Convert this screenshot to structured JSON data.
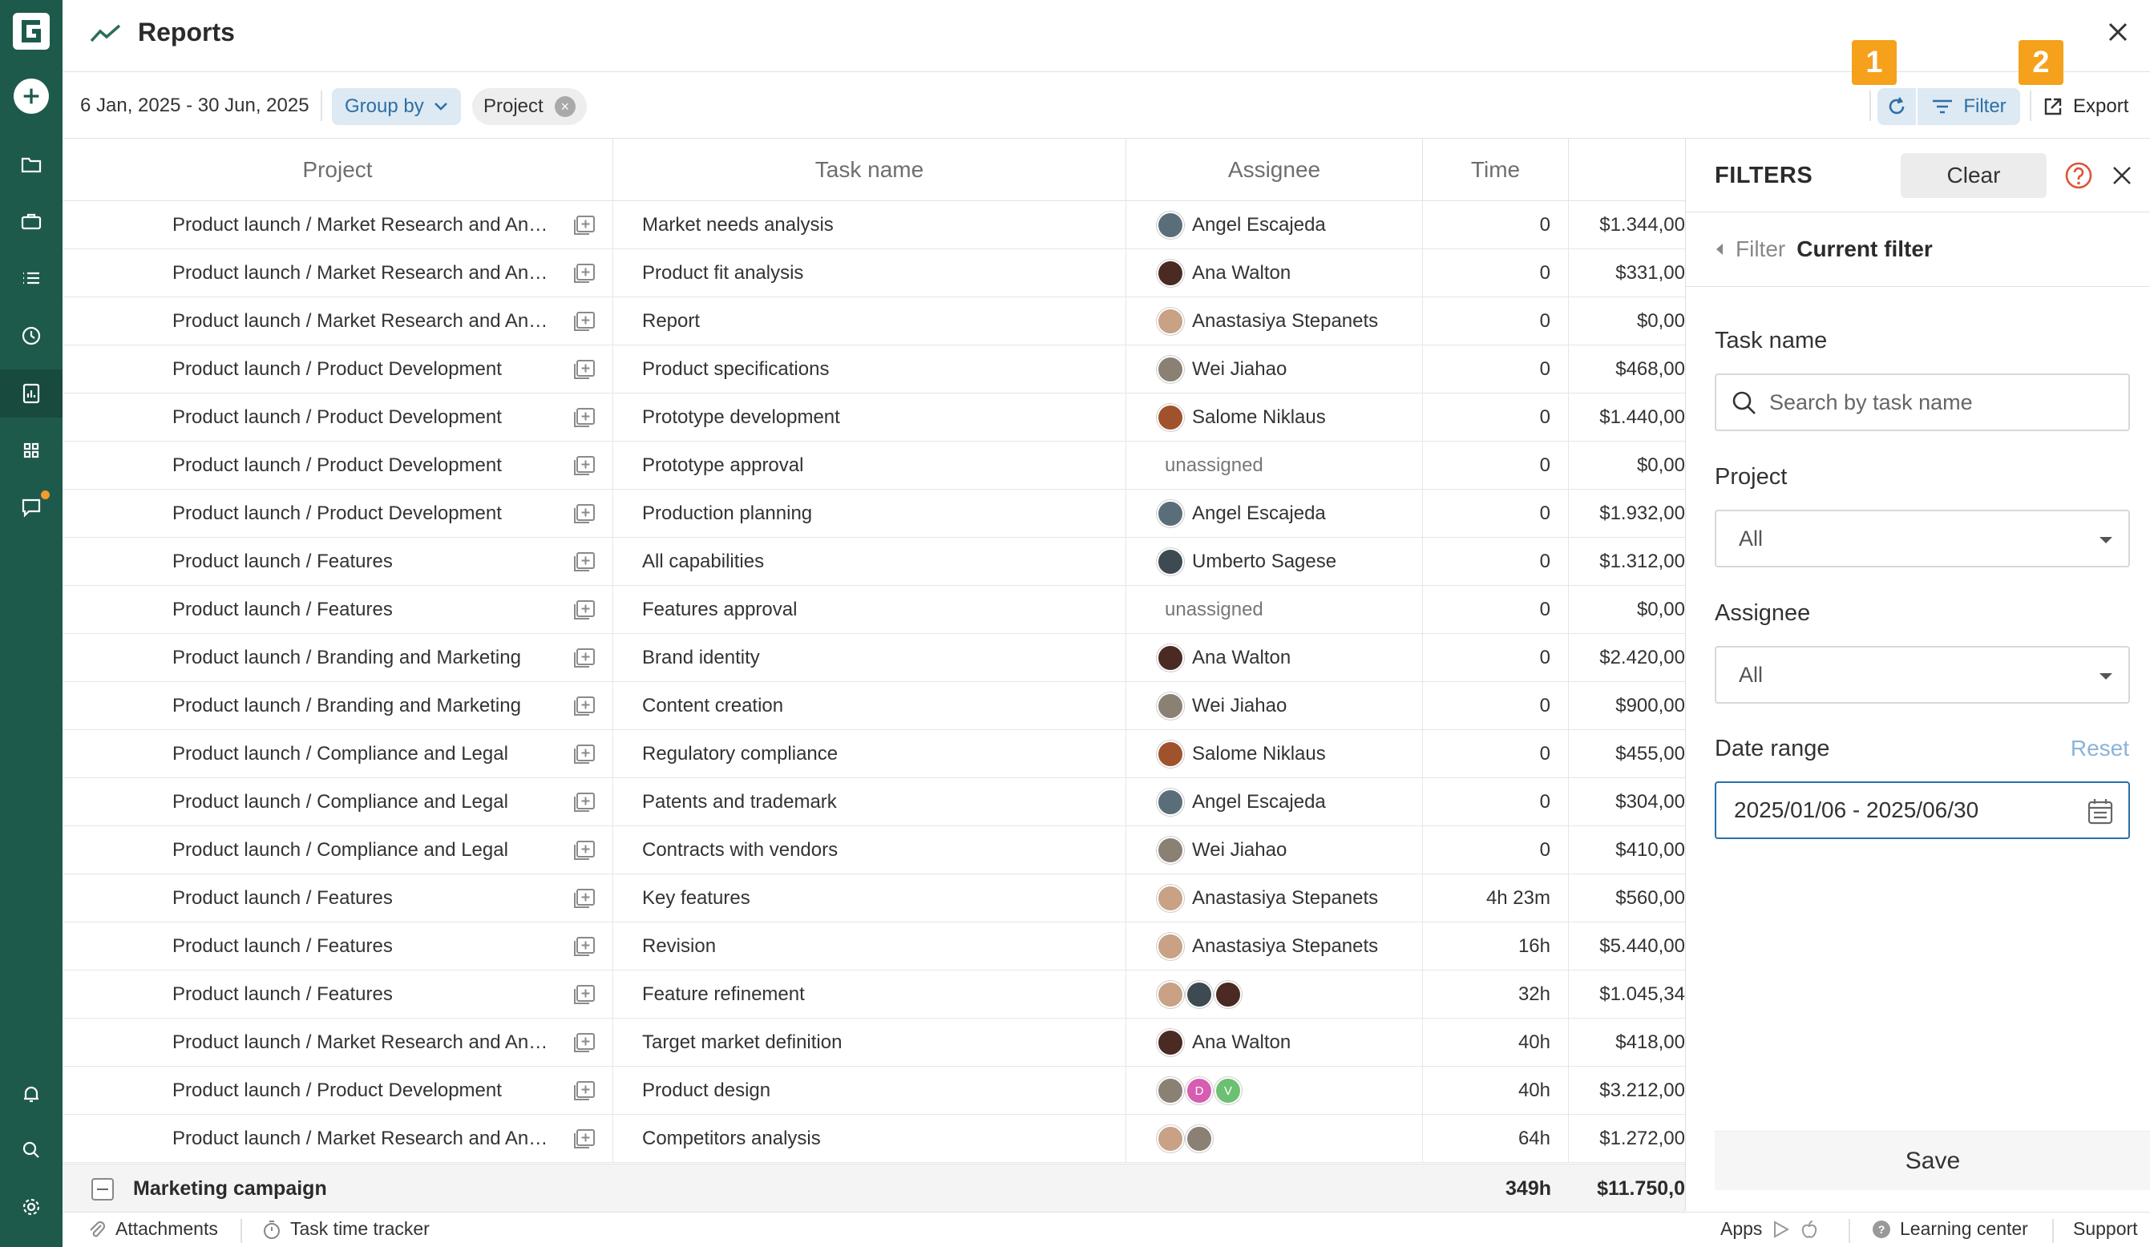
{
  "header": {
    "title": "Reports"
  },
  "toolbar": {
    "date_range": "6 Jan, 2025 - 30 Jun, 2025",
    "group_by_label": "Group by",
    "chip_label": "Project",
    "filter_label": "Filter",
    "export_label": "Export",
    "badge_1": "1",
    "badge_2": "2"
  },
  "table": {
    "columns": [
      "Project",
      "Task name",
      "Assignee",
      "Time"
    ],
    "rows": [
      {
        "project": "Product launch / Market Research and Analysis",
        "task": "Market needs analysis",
        "assignee": "Angel Escajeda",
        "avatars": [
          "#5a6e7a"
        ],
        "time": "0",
        "cost": "$1.344,00"
      },
      {
        "project": "Product launch / Market Research and Analysis",
        "task": "Product fit analysis",
        "assignee": "Ana Walton",
        "avatars": [
          "#4a2a22"
        ],
        "time": "0",
        "cost": "$331,00"
      },
      {
        "project": "Product launch / Market Research and Analysis",
        "task": "Report",
        "assignee": "Anastasiya Stepanets",
        "avatars": [
          "#c9a184"
        ],
        "time": "0",
        "cost": "$0,00"
      },
      {
        "project": "Product launch / Product Development",
        "task": "Product specifications",
        "assignee": "Wei Jiahao",
        "avatars": [
          "#8a8074"
        ],
        "time": "0",
        "cost": "$468,00"
      },
      {
        "project": "Product launch / Product Development",
        "task": "Prototype development",
        "assignee": "Salome Niklaus",
        "avatars": [
          "#a0522d"
        ],
        "time": "0",
        "cost": "$1.440,00"
      },
      {
        "project": "Product launch / Product Development",
        "task": "Prototype approval",
        "assignee": "unassigned",
        "avatars": [],
        "time": "0",
        "cost": "$0,00"
      },
      {
        "project": "Product launch / Product Development",
        "task": "Production planning",
        "assignee": "Angel Escajeda",
        "avatars": [
          "#5a6e7a"
        ],
        "time": "0",
        "cost": "$1.932,00"
      },
      {
        "project": "Product launch / Features",
        "task": "All capabilities",
        "assignee": "Umberto Sagese",
        "avatars": [
          "#3d4a52"
        ],
        "time": "0",
        "cost": "$1.312,00"
      },
      {
        "project": "Product launch / Features",
        "task": "Features approval",
        "assignee": "unassigned",
        "avatars": [],
        "time": "0",
        "cost": "$0,00"
      },
      {
        "project": "Product launch / Branding and Marketing",
        "task": "Brand identity",
        "assignee": "Ana Walton",
        "avatars": [
          "#4a2a22"
        ],
        "time": "0",
        "cost": "$2.420,00"
      },
      {
        "project": "Product launch / Branding and Marketing",
        "task": "Content creation",
        "assignee": "Wei Jiahao",
        "avatars": [
          "#8a8074"
        ],
        "time": "0",
        "cost": "$900,00"
      },
      {
        "project": "Product launch / Compliance and Legal",
        "task": "Regulatory compliance",
        "assignee": "Salome Niklaus",
        "avatars": [
          "#a0522d"
        ],
        "time": "0",
        "cost": "$455,00"
      },
      {
        "project": "Product launch / Compliance and Legal",
        "task": "Patents and trademark",
        "assignee": "Angel Escajeda",
        "avatars": [
          "#5a6e7a"
        ],
        "time": "0",
        "cost": "$304,00"
      },
      {
        "project": "Product launch / Compliance and Legal",
        "task": "Contracts with vendors",
        "assignee": "Wei Jiahao",
        "avatars": [
          "#8a8074"
        ],
        "time": "0",
        "cost": "$410,00"
      },
      {
        "project": "Product launch / Features",
        "task": "Key features",
        "assignee": "Anastasiya Stepanets",
        "avatars": [
          "#c9a184"
        ],
        "time": "4h 23m",
        "cost": "$560,00"
      },
      {
        "project": "Product launch / Features",
        "task": "Revision",
        "assignee": "Anastasiya Stepanets",
        "avatars": [
          "#c9a184"
        ],
        "time": "16h",
        "cost": "$5.440,00"
      },
      {
        "project": "Product launch / Features",
        "task": "Feature refinement",
        "assignee": "",
        "avatars": [
          "#c9a184",
          "#3d4a52",
          "#4a2a22"
        ],
        "time": "32h",
        "cost": "$1.045,34"
      },
      {
        "project": "Product launch / Market Research and Analysis",
        "task": "Target market definition",
        "assignee": "Ana Walton",
        "avatars": [
          "#4a2a22"
        ],
        "time": "40h",
        "cost": "$418,00"
      },
      {
        "project": "Product launch / Product Development",
        "task": "Product design",
        "assignee": "",
        "avatars": [
          "#8a8074",
          "#d65db1",
          "#6cc071"
        ],
        "avatar_letters": [
          "",
          "D",
          "V"
        ],
        "time": "40h",
        "cost": "$3.212,00"
      },
      {
        "project": "Product launch / Market Research and Analysis",
        "task": "Competitors analysis",
        "assignee": "",
        "avatars": [
          "#c9a184",
          "#8a8074"
        ],
        "time": "64h",
        "cost": "$1.272,00"
      }
    ],
    "total": {
      "name": "Marketing campaign",
      "time": "349h",
      "cost": "$11.750,0"
    }
  },
  "panel": {
    "title": "FILTERS",
    "clear_label": "Clear",
    "crumb_back": "Filter",
    "crumb_current": "Current filter",
    "task_name_label": "Task name",
    "task_name_placeholder": "Search by task name",
    "project_label": "Project",
    "project_value": "All",
    "assignee_label": "Assignee",
    "assignee_value": "All",
    "date_label": "Date range",
    "reset_label": "Reset",
    "date_value": "2025/01/06 - 2025/06/30",
    "save_label": "Save"
  },
  "bottombar": {
    "attachments": "Attachments",
    "time_tracker": "Task time tracker",
    "apps": "Apps",
    "learning": "Learning center",
    "support": "Support"
  },
  "colors": {
    "sidebar": "#1e5a4c",
    "accent": "#2c6fa6",
    "badge": "#f5a11c"
  }
}
